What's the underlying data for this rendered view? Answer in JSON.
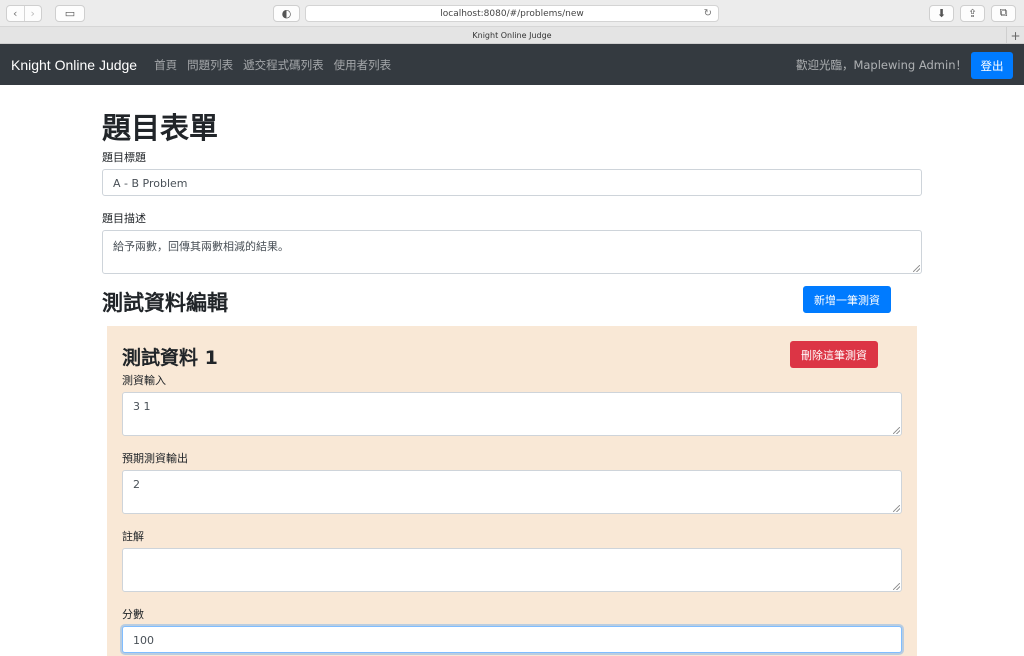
{
  "browser": {
    "url": "localhost:8080/#/problems/new",
    "tab_title": "Knight Online Judge"
  },
  "navbar": {
    "brand": "Knight Online Judge",
    "links": [
      "首頁",
      "問題列表",
      "遞交程式碼列表",
      "使用者列表"
    ],
    "welcome": "歡迎光臨，Maplewing Admin！",
    "logout": "登出"
  },
  "form": {
    "heading": "題目表單",
    "title_label": "題目標題",
    "title_value": "A - B Problem",
    "description_label": "題目描述",
    "description_value": "給予兩數，回傳其兩數相減的結果。"
  },
  "testdata": {
    "heading": "測試資料編輯",
    "add_button": "新增一筆測資",
    "cases": [
      {
        "heading": "測試資料 1",
        "delete_button": "刪除這筆測資",
        "input_label": "測資輸入",
        "input_value": "3 1",
        "output_label": "預期測資輸出",
        "output_value": "2",
        "note_label": "註解",
        "note_value": "",
        "score_label": "分數",
        "score_value": "100"
      }
    ]
  }
}
